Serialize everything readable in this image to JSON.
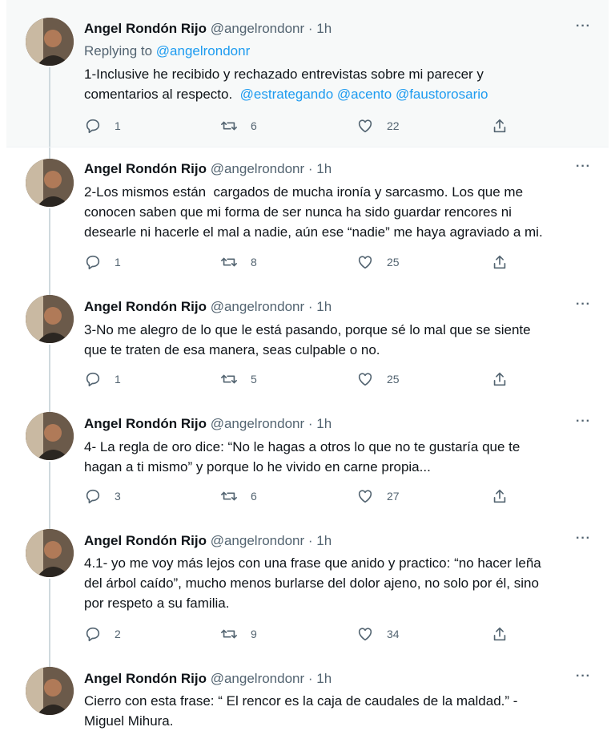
{
  "author": {
    "name": "Angel Rondón Rijo",
    "handle": "@angelrondonr",
    "time": "· 1h"
  },
  "colors": {
    "link": "#1d9bf0",
    "secondary": "#536471",
    "highlight_bg": "#f7f9f9"
  },
  "replying": {
    "prefix": "Replying to ",
    "target": "@angelrondonr"
  },
  "tweets": [
    {
      "text": "1-Inclusive he recibido y rechazado entrevistas sobre mi parecer y\ncomentarios al respecto.",
      "mentions": [
        "@estrategando",
        "@acento",
        "@faustorosario"
      ],
      "replies": "1",
      "retweets": "6",
      "likes": "22"
    },
    {
      "text": "2-Los mismos están  cargados de mucha ironía y sarcasmo. Los que me\nconocen saben que mi forma de ser nunca ha sido guardar rencores ni\ndesearle ni hacerle el mal a nadie, aún ese “nadie” me haya agraviado a mi.",
      "replies": "1",
      "retweets": "8",
      "likes": "25"
    },
    {
      "text": "3-No me alegro de lo que le está pasando, porque sé lo mal que se siente\nque te traten de esa manera, seas culpable o no.",
      "replies": "1",
      "retweets": "5",
      "likes": "25"
    },
    {
      "text": "4- La regla de oro dice: “No le hagas a otros lo que no te gustaría que te\nhagan a ti mismo” y porque lo he vivido en carne propia...",
      "replies": "3",
      "retweets": "6",
      "likes": "27"
    },
    {
      "text": "4.1- yo me voy más lejos con una frase que anido y practico: “no hacer leña\ndel árbol caído”, mucho menos burlarse del dolor ajeno, no solo por él, sino\npor respeto a su familia.",
      "replies": "2",
      "retweets": "9",
      "likes": "34"
    },
    {
      "text": "Cierro con esta frase: “ El rencor es la caja de caudales de la maldad.” -\nMiguel Mihura."
    }
  ]
}
